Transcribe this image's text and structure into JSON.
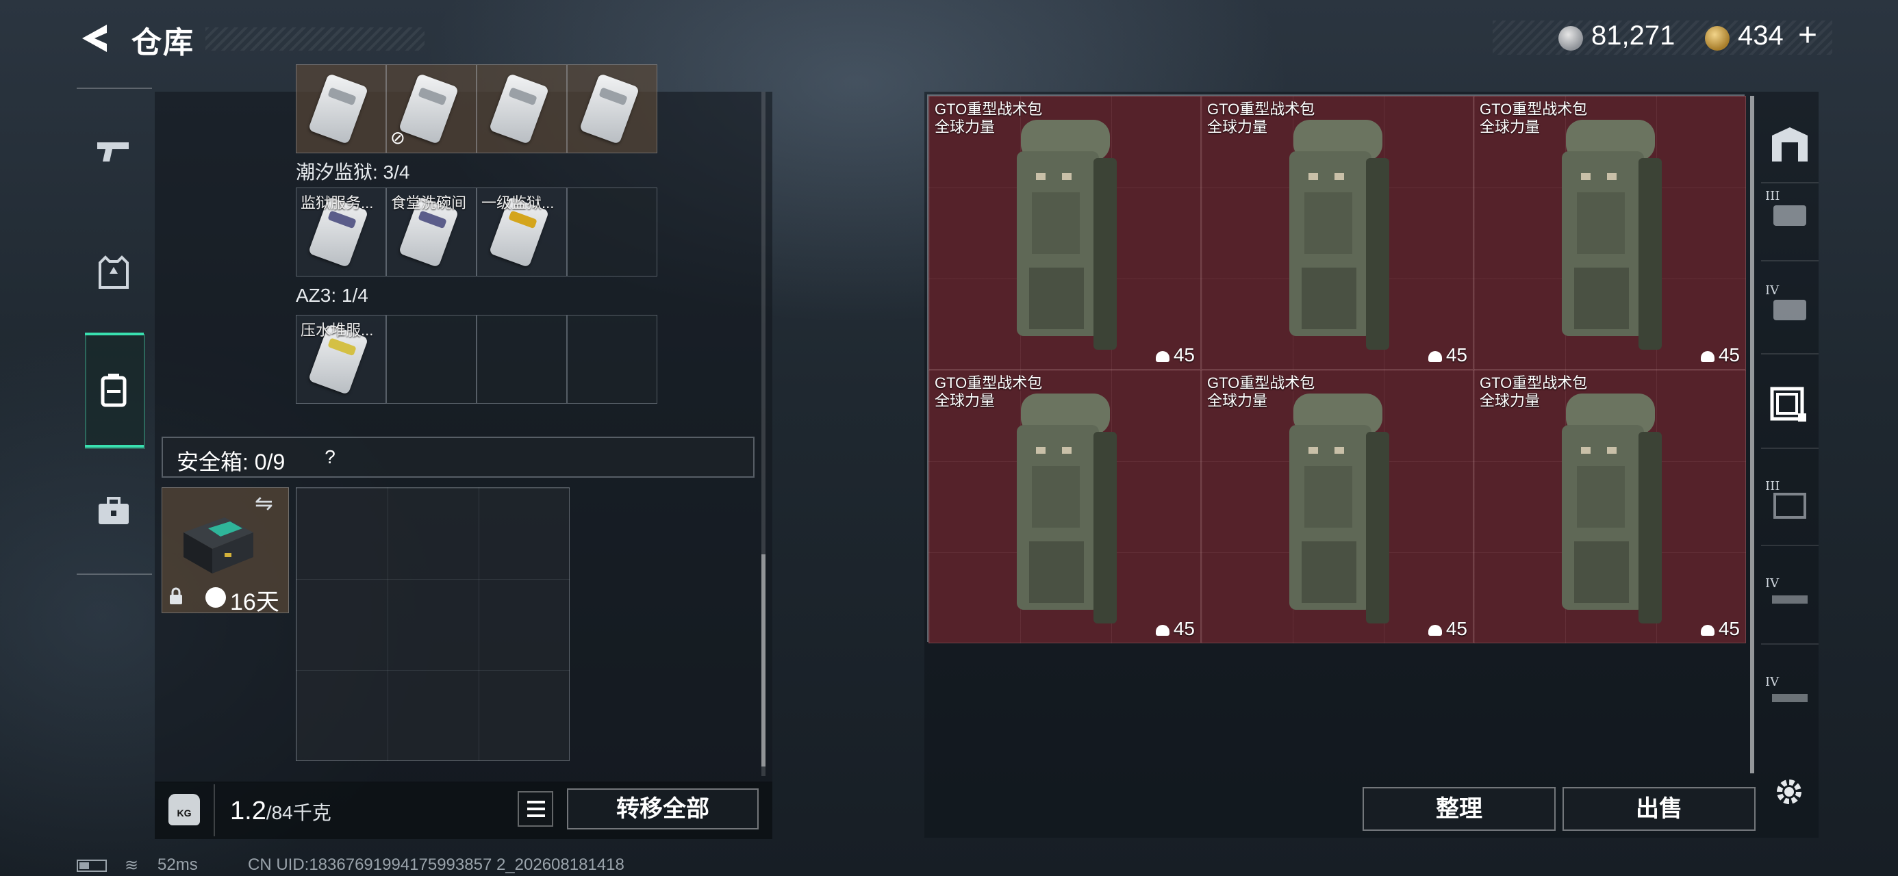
{
  "header": {
    "title": "仓库",
    "currency_silver": "81,271",
    "currency_gold": "434",
    "plus": "+"
  },
  "keycards": {
    "no_discount_symbol": "⊘",
    "section_1": {
      "label": "潮汐监狱: 3/4",
      "items": [
        {
          "name": "监狱服务...",
          "style": "purple"
        },
        {
          "name": "食堂洗碗间",
          "style": "purple"
        },
        {
          "name": "一级监狱...",
          "style": "yellow"
        }
      ]
    },
    "section_2": {
      "label": "AZ3: 1/4",
      "items": [
        {
          "name": "压水堆服...",
          "style": "plain"
        }
      ]
    }
  },
  "safe": {
    "label": "安全箱: 0/9",
    "help": "?",
    "duration": "16天"
  },
  "weight": {
    "current": "1.2",
    "max": "/84千克",
    "kg_label": "KG"
  },
  "buttons": {
    "transfer_all": "转移全部",
    "sort": "整理",
    "sell": "出售"
  },
  "bags": [
    {
      "name": "GTO重型战术包",
      "sub": "全球力量",
      "count": "45"
    },
    {
      "name": "GTO重型战术包",
      "sub": "全球力量",
      "count": "45"
    },
    {
      "name": "GTO重型战术包",
      "sub": "全球力量",
      "count": "45"
    },
    {
      "name": "GTO重型战术包",
      "sub": "全球力量",
      "count": "45"
    },
    {
      "name": "GTO重型战术包",
      "sub": "全球力量",
      "count": "45"
    },
    {
      "name": "GTO重型战术包",
      "sub": "全球力量",
      "count": "45"
    }
  ],
  "right_rail": {
    "tiers": [
      "III",
      "IV",
      "III",
      "IV",
      "IV"
    ]
  },
  "status_bar": {
    "ping": "52ms",
    "uid": "CN UID:18367691994175993857 2_202608181418"
  },
  "colors": {
    "accent": "#39e0b0",
    "bag_cell": "#55222a",
    "safebox_cell": "#5a4837"
  }
}
